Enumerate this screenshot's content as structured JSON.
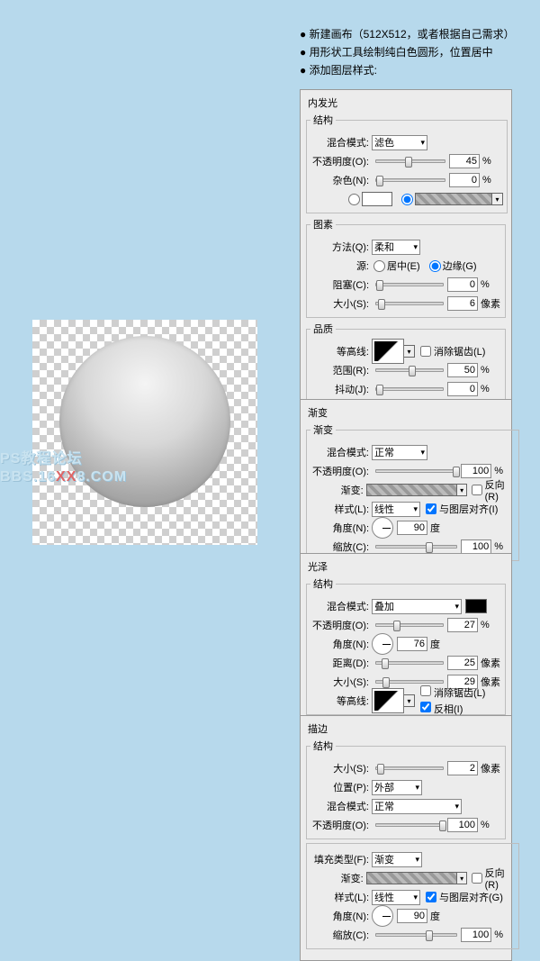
{
  "intro": {
    "l1": "新建画布（512X512，或者根据自己需求）",
    "l2": "用形状工具绘制纯白色圆形，位置居中",
    "l3": "添加图层样式:"
  },
  "watermark": {
    "line1": "PS教程论坛",
    "line2a": "BBS.16",
    "line2b": "XX",
    "line2c": "8.COM"
  },
  "common": {
    "blend": "混合模式:",
    "opacity": "不透明度(O):",
    "pct": "%",
    "px": "像素",
    "deg": "度",
    "size": "大小(S):",
    "angle": "角度(N):",
    "scale": "缩放(C):",
    "gradient": "渐变:",
    "style": "样式(L):",
    "reverse": "反向(R)",
    "align": "与图层对齐(I)",
    "contour": "等高线:",
    "aa": "消除锯齿(L)",
    "struct": "结构"
  },
  "innerGlow": {
    "title": "内发光",
    "mode": "滤色",
    "opacity": 45,
    "noise": 0,
    "noiseLbl": "杂色(N):",
    "elements": "图素",
    "method": "方法(Q):",
    "methodVal": "柔和",
    "source": "源:",
    "center": "居中(E)",
    "edge": "边缘(G)",
    "choke": "阻塞(C):",
    "chokeVal": 0,
    "sizeVal": 6,
    "quality": "品质",
    "range": "范围(R):",
    "rangeVal": 50,
    "jitter": "抖动(J):",
    "jitterVal": 0
  },
  "gradientOverlay": {
    "title": "渐变",
    "mode": "正常",
    "opacity": 100,
    "styleVal": "线性",
    "angle": 90,
    "scale": 100
  },
  "satin": {
    "title": "光泽",
    "mode": "叠加",
    "opacity": 27,
    "angle": 76,
    "distance": "距离(D):",
    "distanceVal": 25,
    "sizeVal": 29,
    "invert": "反相(I)"
  },
  "stroke": {
    "title": "描边",
    "sizeVal": 2,
    "position": "位置(P):",
    "positionVal": "外部",
    "mode": "正常",
    "opacity": 100,
    "fillType": "填充类型(F):",
    "fillTypeVal": "渐变",
    "styleVal": "线性",
    "alignG": "与图层对齐(G)",
    "angle": 90,
    "scale": 100
  }
}
